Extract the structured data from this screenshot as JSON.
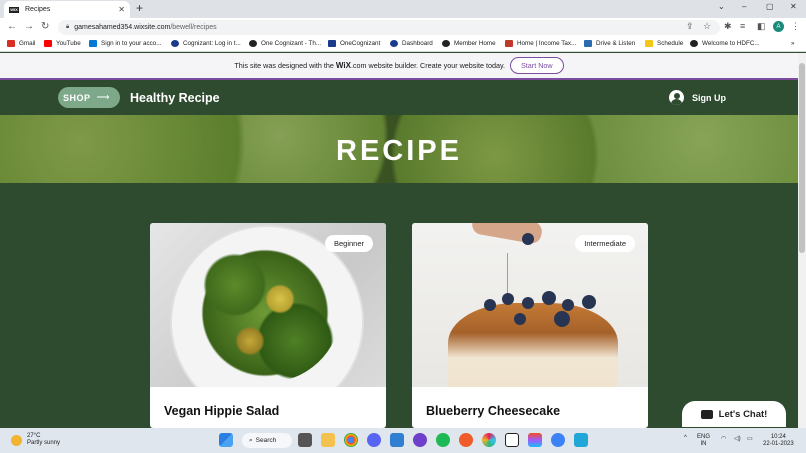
{
  "browser": {
    "tab_title": "Recipes",
    "tab_favicon": "WIX",
    "url_domain": "gamesahamed354.wixsite.com",
    "url_path": "/bewell/recipes",
    "profile_initial": "A"
  },
  "bookmarks": [
    {
      "label": "Gmail",
      "color": "#d93025"
    },
    {
      "label": "YouTube",
      "color": "#ff0000"
    },
    {
      "label": "Sign in to your acco...",
      "color": "#0078d4"
    },
    {
      "label": "Cognizant: Log in t...",
      "color": "#1a3b8c"
    },
    {
      "label": "One Cognizant - Th...",
      "color": "#222222"
    },
    {
      "label": "OneCognizant",
      "color": "#1a3b8c"
    },
    {
      "label": "Dashboard",
      "color": "#1a3b8c"
    },
    {
      "label": "Member Home",
      "color": "#222222"
    },
    {
      "label": "Home | Income Tax...",
      "color": "#c0392b"
    },
    {
      "label": "Drive & Listen",
      "color": "#2b6cb0"
    },
    {
      "label": "Schedule",
      "color": "#f5c518"
    },
    {
      "label": "Welcome to HDFC...",
      "color": "#222222"
    }
  ],
  "wix_banner": {
    "message_pre": "This site was designed with the ",
    "brand": "WiX",
    "brand_suffix": ".com",
    "message_post": " website builder. Create your website today.",
    "cta": "Start Now"
  },
  "site": {
    "shop_label": "SHOP",
    "shop_arrow": "⟶",
    "name": "Healthy Recipe",
    "signup_label": "Sign Up"
  },
  "hero": {
    "title": "RECIPE"
  },
  "recipes": [
    {
      "title": "Vegan Hippie Salad",
      "level": "Beginner"
    },
    {
      "title": "Blueberry Cheesecake",
      "level": "Intermediate"
    }
  ],
  "chat": {
    "label": "Let's Chat!"
  },
  "taskbar": {
    "temperature": "27°C",
    "weather": "Partly sunny",
    "search_label": "Search",
    "lang_top": "ENG",
    "lang_bottom": "IN",
    "time": "10:24",
    "date": "22-01-2023"
  },
  "icons": {
    "favicon": "wix-favicon-icon",
    "signup": "user-avatar-icon",
    "chat": "chat-bubble-icon",
    "weather": "partly-sunny-icon"
  }
}
